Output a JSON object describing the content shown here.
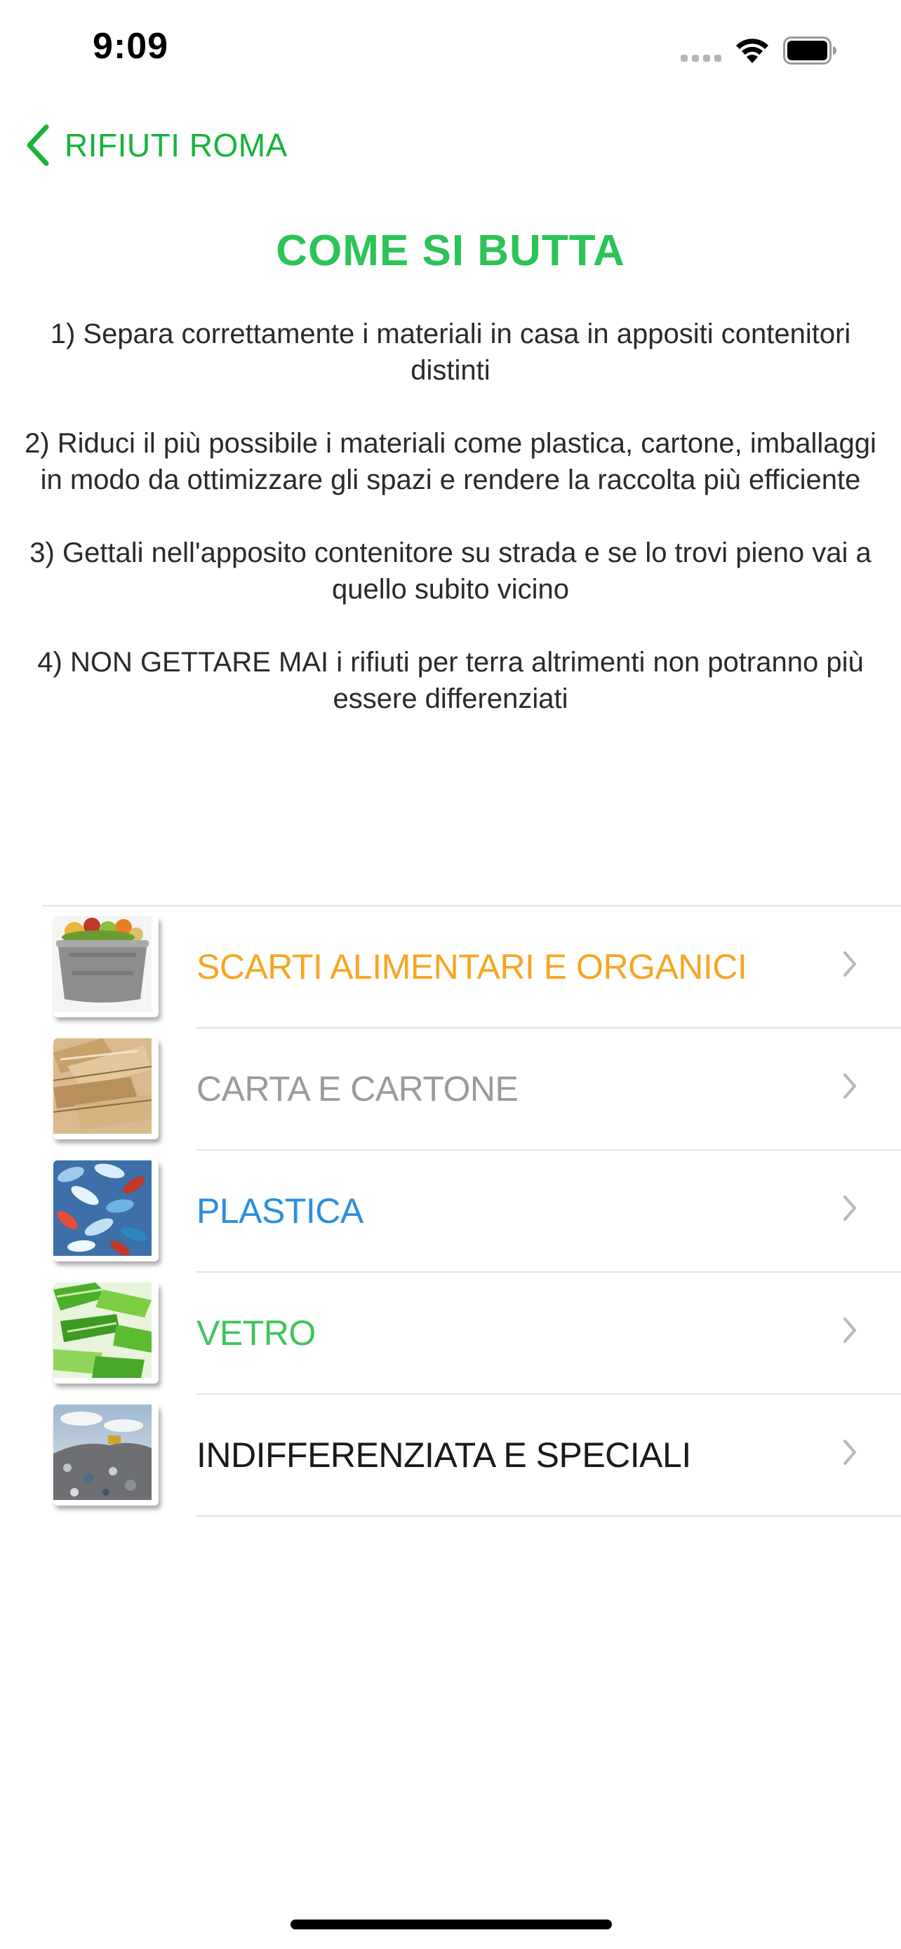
{
  "status_bar": {
    "time": "9:09",
    "signal_icon": "cellular-signal-icon",
    "wifi_icon": "wifi-icon",
    "battery_icon": "battery-icon"
  },
  "navigation": {
    "back_label": "RIFIUTI ROMA",
    "back_icon": "chevron-left-icon",
    "accent_color": "#19b23b"
  },
  "header": {
    "title": "COME SI BUTTA",
    "title_color": "#2cc357"
  },
  "instructions": [
    "1) Separa correttamente i materiali in casa in appositi contenitori distinti",
    "2) Riduci il più possibile i materiali come plastica, cartone, imballaggi in modo da ottimizzare gli spazi e rendere la raccolta più efficiente",
    "3) Gettali nell'apposito contenitore su strada e se lo trovi pieno vai a quello subito vicino",
    "4) NON GETTARE MAI i rifiuti per terra altrimenti non potranno più essere differenziati"
  ],
  "categories": [
    {
      "label": "SCARTI ALIMENTARI E ORGANICI",
      "color": "#f5a623",
      "thumbnail": "organic-waste-bin-photo"
    },
    {
      "label": "CARTA E CARTONE",
      "color": "#9b9b9b",
      "thumbnail": "cardboard-pile-photo"
    },
    {
      "label": "PLASTICA",
      "color": "#2b8ee0",
      "thumbnail": "plastic-bottles-photo"
    },
    {
      "label": "VETRO",
      "color": "#3ec45e",
      "thumbnail": "green-glass-bottles-photo"
    },
    {
      "label": "INDIFFERENZIATA E SPECIALI",
      "color": "#1a1a1a",
      "thumbnail": "landfill-photo"
    }
  ],
  "row_chevron_icon": "chevron-right-icon"
}
